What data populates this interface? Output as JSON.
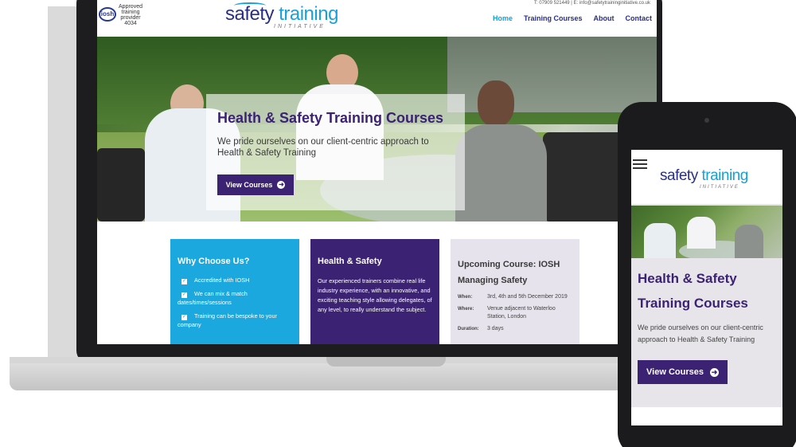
{
  "header": {
    "badge_text": "iosh",
    "approved_lines": [
      "Approved",
      "training",
      "provider",
      "4034"
    ],
    "logo_word1": "safety",
    "logo_word2": "training",
    "logo_sub": "INITIATIVE",
    "contact": "T: 07909 521449   |   E: info@safetytraininginitiative.co.uk",
    "nav": [
      {
        "label": "Home",
        "active": true
      },
      {
        "label": "Training Courses"
      },
      {
        "label": "About"
      },
      {
        "label": "Contact"
      }
    ]
  },
  "hero": {
    "title": "Health & Safety Training Courses",
    "text": "We pride ourselves on our client-centric approach to Health & Safety Training",
    "button": "View Courses",
    "arrow_icon": "➜"
  },
  "cards": {
    "why": {
      "title": "Why Choose Us?",
      "items": [
        "Accredited with IOSH",
        "We can mix & match dates/times/sessions",
        "Training can be bespoke to your company"
      ],
      "check_icon": "✓"
    },
    "hs": {
      "title": "Health & Safety",
      "text": "Our experienced trainers combine real life industry experience, with an innovative, and exciting teaching style allowing delegates, of any level, to really understand the subject."
    },
    "upcoming": {
      "title": "Upcoming Course: IOSH Managing Safety",
      "rows": [
        {
          "key": "When:",
          "value": "3rd, 4th and 5th December 2019"
        },
        {
          "key": "Where:",
          "value": "Venue adjacent to Waterloo Station, London"
        },
        {
          "key": "Duration:",
          "value": "3 days"
        }
      ]
    }
  },
  "mobile": {
    "logo_word1": "safety",
    "logo_word2": "training",
    "logo_sub": "INITIATIVE",
    "title": "Health & Safety Training Courses",
    "text": "We pride ourselves on our client-centric approach to Health & Safety Training",
    "button": "View Courses",
    "arrow_icon": "➜"
  },
  "colors": {
    "brand_purple": "#3b2272",
    "brand_blue": "#1aa8df",
    "logo_navy": "#2a2f86"
  }
}
